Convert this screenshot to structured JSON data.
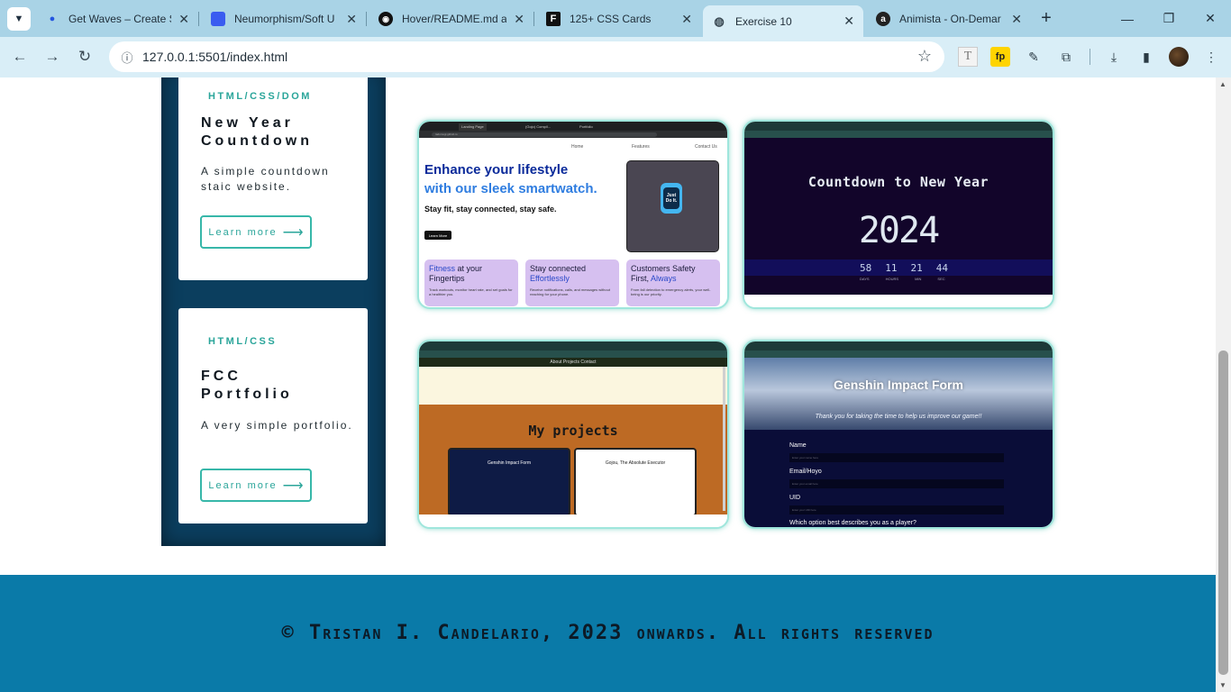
{
  "browser": {
    "tabs": [
      {
        "title": "Get Waves – Create S",
        "icon": "waves-icon",
        "active": false
      },
      {
        "title": "Neumorphism/Soft U",
        "icon": "neumorphism-icon",
        "active": false
      },
      {
        "title": "Hover/README.md at",
        "icon": "github-icon",
        "active": false
      },
      {
        "title": "125+ CSS Cards",
        "icon": "freefrontend-icon",
        "active": false
      },
      {
        "title": "Exercise 10",
        "icon": "globe-icon",
        "active": true
      },
      {
        "title": "Animista - On-Demar",
        "icon": "animista-icon",
        "active": false
      }
    ],
    "url": "127.0.0.1:5501/index.html",
    "extensions": {
      "t": "T",
      "fp": "fp"
    }
  },
  "projects": [
    {
      "tag": "HTML/CSS/DOM",
      "title_lines": [
        "New Year",
        "Countdown"
      ],
      "description": "A simple countdown staic website.",
      "button": "Learn more"
    },
    {
      "tag": "HTML/CSS",
      "title_lines": [
        "FCC",
        "Portfolio"
      ],
      "description": "A very simple portfolio.",
      "button": "Learn more"
    }
  ],
  "screenshots": {
    "landing": {
      "nav": [
        "Home",
        "Features",
        "Contact Us"
      ],
      "headline_a": "Enhance your lifestyle",
      "headline_b": "with our sleek smartwatch.",
      "headline_small": "Stay fit, stay connected, stay safe.",
      "cta": "Learn More",
      "watch_text": "Just Do It.",
      "features": [
        {
          "title_hl": "Fitness",
          "title_rest": " at your Fingertips",
          "desc": "Track workouts, monitor heart rate, and set goals for a healthier you."
        },
        {
          "title_rest": "Stay connected ",
          "title_hl": "Effortlessly",
          "desc": "Receive notifications, calls, and messages without reaching for your phone."
        },
        {
          "title_rest": "Customers Safety First, ",
          "title_hl": "Always",
          "desc": "From fall detection to emergency alerts, your well-being is our priority."
        }
      ]
    },
    "countdown": {
      "title": "Countdown to New Year",
      "year": "2024",
      "numbers": [
        "58",
        "11",
        "21",
        "44"
      ],
      "labels": [
        "DAYS",
        "HOURS",
        "MIN",
        "SEC"
      ]
    },
    "portfolio": {
      "nav": "About  Projects  Contact",
      "heading": "My projects",
      "project_a": "Genshin Impact Form",
      "project_b": "Gojou, The Absolute Executor"
    },
    "genshin": {
      "title": "Genshin Impact Form",
      "subtitle": "Thank you for taking the time to help us improve our game!!",
      "fields": [
        {
          "label": "Name",
          "placeholder": "Enter your name here"
        },
        {
          "label": "Email/Hoyo",
          "placeholder": "Enter your email here"
        },
        {
          "label": "UID",
          "placeholder": "Enter your UID here"
        }
      ],
      "question": "Which option best describes you as a player?"
    }
  },
  "footer": {
    "text": "© Tristan I. Candelario, 2023 onwards. All rights reserved"
  },
  "colors": {
    "accent": "#2aa59a",
    "sidebar": "#0b3e5e",
    "footer": "#0a7aa8"
  }
}
